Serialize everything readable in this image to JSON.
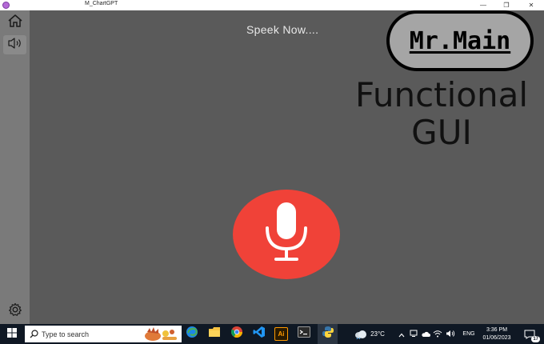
{
  "window": {
    "title": "M_ChartGPT",
    "minimize_glyph": "—",
    "maximize_glyph": "❐",
    "close_glyph": "✕"
  },
  "sidebar": {
    "items": [
      {
        "name": "home",
        "icon": "home-icon"
      },
      {
        "name": "speaker",
        "icon": "speaker-icon",
        "selected": true
      },
      {
        "name": "settings",
        "icon": "gear-icon"
      }
    ]
  },
  "main": {
    "status_text": "Speek Now....",
    "logo_text": "Mr.Main",
    "headline_line1": "Functional",
    "headline_line2": "GUI",
    "mic_button_color": "#f04238"
  },
  "taskbar": {
    "search_placeholder": "Type to search",
    "apps": [
      "edge",
      "file-explorer",
      "chrome",
      "vscode",
      "illustrator",
      "terminal",
      "python"
    ],
    "illustrator_label": "Ai",
    "weather_temp": "23°C",
    "language": "ENG",
    "time": "3:36 PM",
    "date": "01/06/2023",
    "notification_count": "17"
  },
  "colors": {
    "background": "#5a5a5a",
    "sidebar": "#7a7a7a",
    "accent_red": "#f04238",
    "taskbar": "#0f1824"
  }
}
